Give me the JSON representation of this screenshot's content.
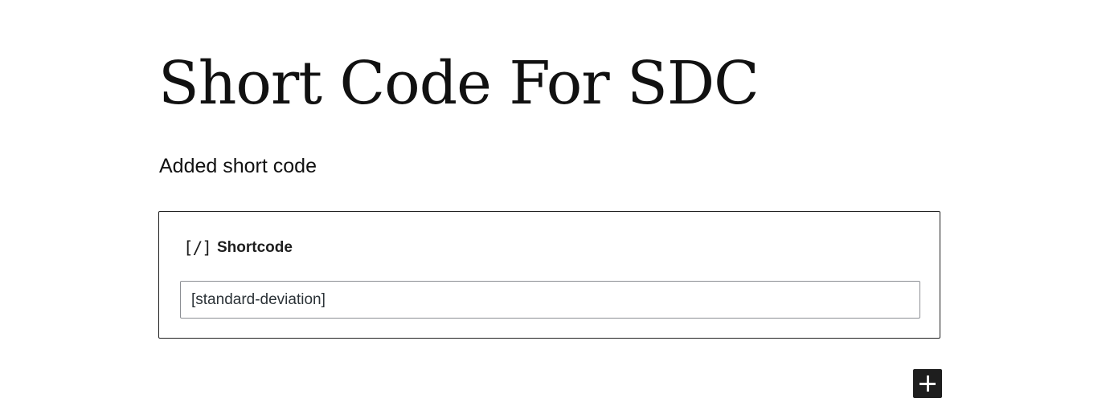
{
  "post": {
    "title": "Short Code For SDC",
    "paragraph": "Added short code"
  },
  "shortcode_block": {
    "icon": "shortcode-icon",
    "icon_glyph": "[/]",
    "label": "Shortcode",
    "input_value": "[standard-deviation]"
  },
  "inserter": {
    "icon": "plus-icon"
  },
  "colors": {
    "text": "#1e1e1e",
    "inserter_bg": "#1e1e1e",
    "input_border": "#8c8f94"
  }
}
